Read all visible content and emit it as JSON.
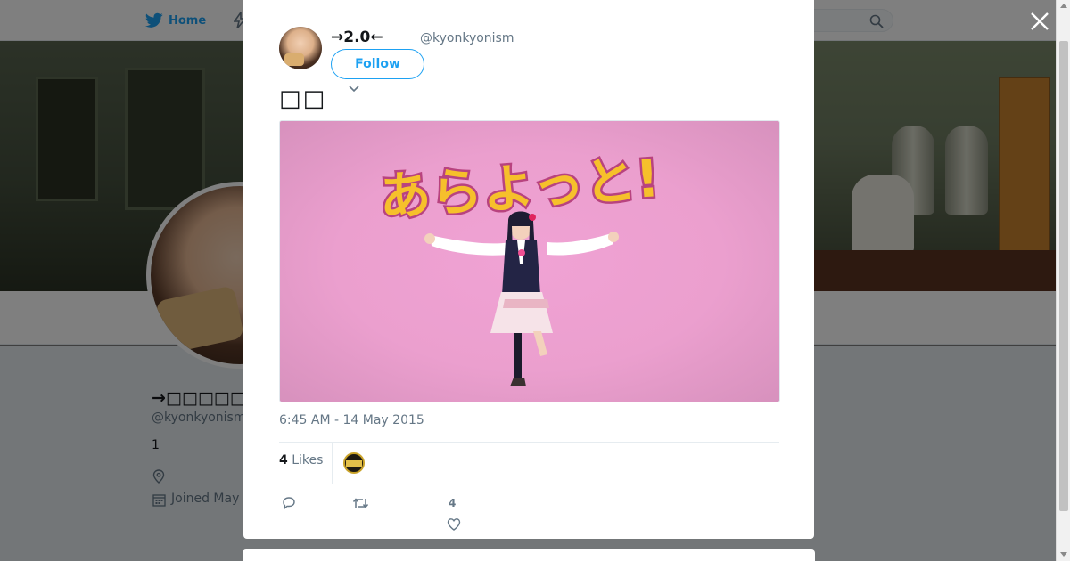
{
  "nav": {
    "home_label": "Home"
  },
  "profile": {
    "name": "→□□□□□□□□",
    "handle": "@kyonkyonism",
    "bio": "1",
    "joined": "Joined May"
  },
  "tweet": {
    "author_name": "→2.0←",
    "author_handle": "@kyonkyonism",
    "follow_label": "Follow",
    "text": "□□",
    "media_text": "あらよっと!",
    "timestamp": "6:45 AM - 14 May 2015",
    "likes_count": "4",
    "likes_label": "Likes",
    "like_action_count": "4"
  },
  "colors": {
    "accent": "#1da1f2",
    "muted": "#657786",
    "media_background": "#eba0cf",
    "media_title_fill": "#f6c02b",
    "media_title_outline": "#b8437f"
  },
  "icons": {
    "home": "twitter-bird-icon",
    "moments": "lightning-icon",
    "search": "search-icon",
    "close": "close-icon",
    "caret": "chevron-down-icon",
    "location": "location-pin-icon",
    "calendar": "calendar-icon",
    "reply": "reply-icon",
    "retweet": "retweet-icon",
    "like": "heart-icon"
  }
}
